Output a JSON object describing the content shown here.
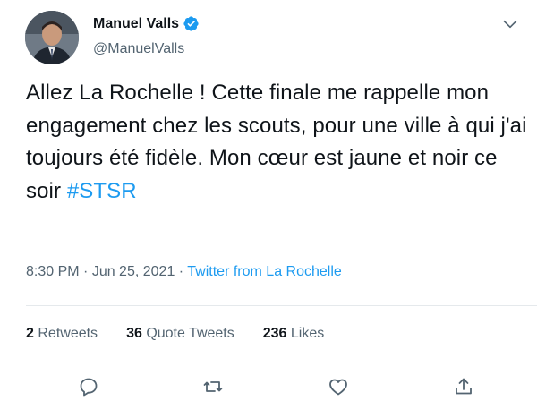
{
  "author": {
    "name": "Manuel Valls",
    "handle": "@ManuelValls",
    "verified": true
  },
  "tweet": {
    "text_before": "Allez La Rochelle ! Cette finale me rappelle mon engagement chez les scouts, pour une ville à qui j'ai toujours été fidèle. Mon cœur est jaune et noir ce soir ",
    "hashtag": "#STSR",
    "time": "8:30 PM",
    "date": "Jun 25, 2021",
    "separator": " · ",
    "source": "Twitter from La Rochelle"
  },
  "stats": {
    "retweets_count": "2",
    "retweets_label": "Retweets",
    "quotes_count": "36",
    "quotes_label": "Quote Tweets",
    "likes_count": "236",
    "likes_label": "Likes"
  },
  "icons": {
    "reply": "reply-icon",
    "retweet": "retweet-icon",
    "like": "heart-icon",
    "share": "share-icon",
    "more": "chevron-down-icon"
  },
  "colors": {
    "accent": "#1d9bf0",
    "text": "#0f1419",
    "secondary": "#536471"
  }
}
